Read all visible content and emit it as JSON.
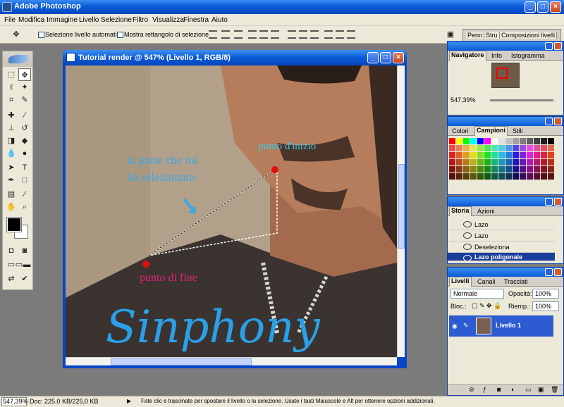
{
  "app": {
    "title": "Adobe Photoshop"
  },
  "menu": [
    "File",
    "Modifica",
    "Immagine",
    "Livello",
    "Selezione",
    "Filtro",
    "Visualizza",
    "Finestra",
    "Aiuto"
  ],
  "options": {
    "auto_select_label": "Selezione livello automatica",
    "bounding_box_label": "Mostra rettangolo di selezione",
    "palette_well_tabs": [
      "Penn",
      "Stru",
      "Composizioni livelli"
    ]
  },
  "document": {
    "title": "Tutorial render @ 547% (Livello 1, RGB/8)"
  },
  "annotations": {
    "selected_part_line1": "la parte che mi",
    "selected_part_line2": "ha selezionato",
    "start_point": "punto d'inizio",
    "end_point": "punto di fine",
    "signature": "Sinphony"
  },
  "navigator": {
    "tabs": [
      "Navigatore",
      "Info",
      "Istogramma"
    ],
    "zoom": "547,39%"
  },
  "swatches": {
    "tabs": [
      "Colori",
      "Campioni",
      "Stili"
    ]
  },
  "history": {
    "tabs": [
      "Storia",
      "Azioni"
    ],
    "items": [
      {
        "label": "Lazo",
        "selected": false
      },
      {
        "label": "Lazo",
        "selected": false
      },
      {
        "label": "Deseleziona",
        "selected": false
      },
      {
        "label": "Lazo poligonale",
        "selected": true
      }
    ]
  },
  "layers": {
    "tabs": [
      "Livelli",
      "Canali",
      "Tracciati"
    ],
    "blend_mode": "Normale",
    "opacity_label": "Opacità:",
    "opacity_value": "100%",
    "lock_label": "Bloc.:",
    "fill_label": "Riemp.:",
    "fill_value": "100%",
    "layer_name": "Livello 1"
  },
  "status": {
    "zoom": "547,39%",
    "doc_info": "Doc: 225,0 KB/225,0 KB",
    "hint": "Fate clic e trascinate per spostare il livello o la selezione.  Usate i tasti Maiuscole e Alt per ottenere opzioni addizionali."
  },
  "colors": {
    "xp_blue": "#0a5ad6",
    "start_dot": "#e01010",
    "end_dot": "#e01010",
    "annotation_cyan": "#3fc7e6",
    "annotation_pink": "#e0207c"
  }
}
